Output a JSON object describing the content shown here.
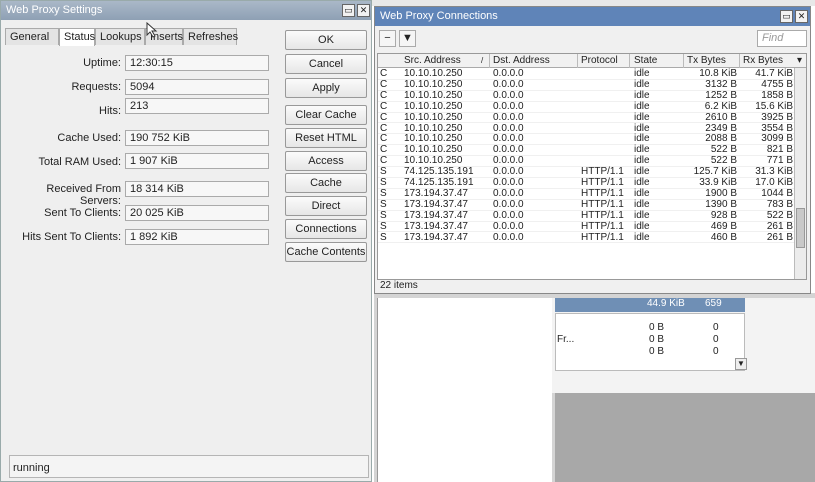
{
  "settings": {
    "title": "Web Proxy Settings",
    "tabs": [
      "General",
      "Status",
      "Lookups",
      "Inserts",
      "Refreshes"
    ],
    "active_tab": "Status",
    "fields": [
      {
        "label": "Uptime:",
        "value": "12:30:15"
      },
      {
        "label": "Requests:",
        "value": "5094"
      },
      {
        "label": "Hits:",
        "value": "213"
      },
      {
        "label": "Cache Used:",
        "value": "190 752 KiB"
      },
      {
        "label": "Total RAM Used:",
        "value": "1 907 KiB"
      },
      {
        "label": "Received From Servers:",
        "value": "18 314 KiB"
      },
      {
        "label": "Sent To Clients:",
        "value": "20 025 KiB"
      },
      {
        "label": "Hits Sent To Clients:",
        "value": "1 892 KiB"
      }
    ],
    "buttons": [
      "OK",
      "Cancel",
      "Apply",
      "Clear Cache",
      "Reset HTML",
      "Access",
      "Cache",
      "Direct",
      "Connections",
      "Cache Contents"
    ],
    "status": "running"
  },
  "connections": {
    "title": "Web Proxy Connections",
    "find_placeholder": "Find",
    "columns": [
      "Src. Address",
      "Dst. Address",
      "Protocol",
      "State",
      "Tx Bytes",
      "Rx Bytes"
    ],
    "rows": [
      [
        "C",
        "10.10.10.250",
        "0.0.0.0",
        "",
        "idle",
        "10.8 KiB",
        "41.7 KiB"
      ],
      [
        "C",
        "10.10.10.250",
        "0.0.0.0",
        "",
        "idle",
        "3132 B",
        "4755 B"
      ],
      [
        "C",
        "10.10.10.250",
        "0.0.0.0",
        "",
        "idle",
        "1252 B",
        "1858 B"
      ],
      [
        "C",
        "10.10.10.250",
        "0.0.0.0",
        "",
        "idle",
        "6.2 KiB",
        "15.6 KiB"
      ],
      [
        "C",
        "10.10.10.250",
        "0.0.0.0",
        "",
        "idle",
        "2610 B",
        "3925 B"
      ],
      [
        "C",
        "10.10.10.250",
        "0.0.0.0",
        "",
        "idle",
        "2349 B",
        "3554 B"
      ],
      [
        "C",
        "10.10.10.250",
        "0.0.0.0",
        "",
        "idle",
        "2088 B",
        "3099 B"
      ],
      [
        "C",
        "10.10.10.250",
        "0.0.0.0",
        "",
        "idle",
        "522 B",
        "821 B"
      ],
      [
        "C",
        "10.10.10.250",
        "0.0.0.0",
        "",
        "idle",
        "522 B",
        "771 B"
      ],
      [
        "S",
        "74.125.135.191",
        "0.0.0.0",
        "HTTP/1.1",
        "idle",
        "125.7 KiB",
        "31.3 KiB"
      ],
      [
        "S",
        "74.125.135.191",
        "0.0.0.0",
        "HTTP/1.1",
        "idle",
        "33.9 KiB",
        "17.0 KiB"
      ],
      [
        "S",
        "173.194.37.47",
        "0.0.0.0",
        "HTTP/1.1",
        "idle",
        "1900 B",
        "1044 B"
      ],
      [
        "S",
        "173.194.37.47",
        "0.0.0.0",
        "HTTP/1.1",
        "idle",
        "1390 B",
        "783 B"
      ],
      [
        "S",
        "173.194.37.47",
        "0.0.0.0",
        "HTTP/1.1",
        "idle",
        "928 B",
        "522 B"
      ],
      [
        "S",
        "173.194.37.47",
        "0.0.0.0",
        "HTTP/1.1",
        "idle",
        "469 B",
        "261 B"
      ],
      [
        "S",
        "173.194.37.47",
        "0.0.0.0",
        "HTTP/1.1",
        "idle",
        "460 B",
        "261 B"
      ]
    ],
    "count": "22 items"
  },
  "background": {
    "header_value": "44.9 KiB",
    "header_value2": "659",
    "fragment": "Fr...",
    "rows": [
      [
        "0 B",
        "0"
      ],
      [
        "0 B",
        "0"
      ],
      [
        "0 B",
        "0"
      ]
    ]
  },
  "colors": {
    "title_active": "#5f84b8",
    "title_inactive": "#8ea0b4"
  }
}
